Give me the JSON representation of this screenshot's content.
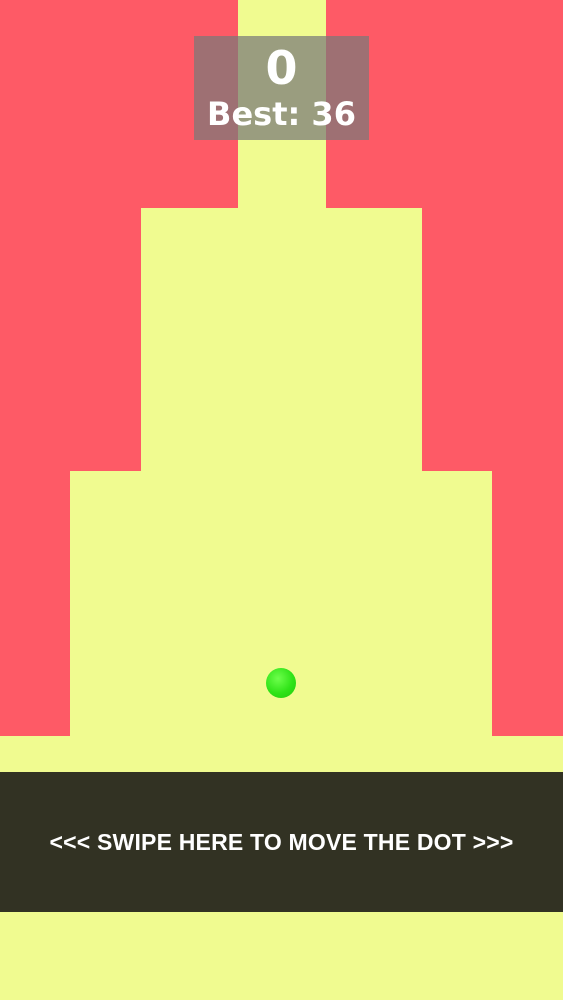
{
  "scoreboard": {
    "score": "0",
    "best": "Best: 36"
  },
  "swipe_area": {
    "text": "<<< SWIPE HERE TO MOVE THE DOT >>>"
  },
  "colors": {
    "background": "#fe5a66",
    "path": "#f0fb90",
    "dot": "#30e318",
    "swipe_panel": "#323223",
    "text": "#ffffff"
  }
}
